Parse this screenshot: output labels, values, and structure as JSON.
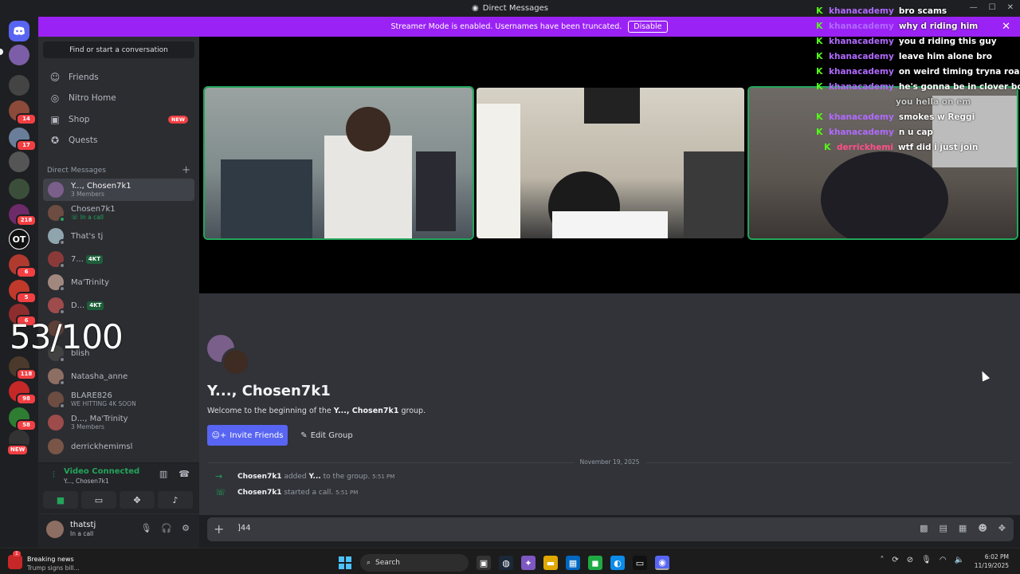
{
  "window": {
    "title": "Direct Messages"
  },
  "banner": {
    "text": "Streamer Mode is enabled. Usernames have been truncated.",
    "disable_label": "Disable"
  },
  "rail": {
    "badges": [
      "14",
      "17",
      "218",
      "6",
      "5",
      "6",
      "118",
      "98",
      "58",
      "NEW"
    ]
  },
  "sidebar": {
    "search_placeholder": "Find or start a conversation",
    "nav": [
      {
        "label": "Friends",
        "icon": "friends-icon"
      },
      {
        "label": "Nitro Home",
        "icon": "nitro-icon"
      },
      {
        "label": "Shop",
        "icon": "shop-icon",
        "badge": "NEW"
      },
      {
        "label": "Quests",
        "icon": "quests-icon"
      }
    ],
    "dm_header": "Direct Messages",
    "dms": [
      {
        "name": "Y..., Chosen7k1",
        "sub": "3 Members"
      },
      {
        "name": "Chosen7k1",
        "sub": "In a call"
      },
      {
        "name": "That's tj",
        "sub": ""
      },
      {
        "name": "7...",
        "sub": "",
        "tag": "4KT"
      },
      {
        "name": "Ma'Trinity",
        "sub": ""
      },
      {
        "name": "D...",
        "sub": "",
        "tag": "4KT"
      },
      {
        "name": "",
        "sub": ""
      },
      {
        "name": "blish",
        "sub": ""
      },
      {
        "name": "Natasha_anne",
        "sub": ""
      },
      {
        "name": "BLARE826",
        "sub": "WE HITTING 4K SOON"
      },
      {
        "name": "D..., Ma'Trinity",
        "sub": "3 Members"
      },
      {
        "name": "derrickhemimsl",
        "sub": ""
      }
    ]
  },
  "voice": {
    "status": "Video Connected",
    "channel": "Y..., Chosen7k1"
  },
  "user": {
    "name": "thatstj",
    "status": "In a call"
  },
  "group": {
    "title": "Y..., Chosen7k1",
    "welcome_prefix": "Welcome to the beginning of the ",
    "welcome_name": "Y..., Chosen7k1",
    "welcome_suffix": " group.",
    "invite_label": "Invite Friends",
    "edit_label": "Edit Group"
  },
  "messages": {
    "date": "November 19, 2025",
    "items": [
      {
        "actor": "Chosen7k1",
        "text_a": " added ",
        "target": "Y...",
        "text_b": " to the group.",
        "time": "5:51 PM"
      },
      {
        "actor": "Chosen7k1",
        "text_a": " started a call.",
        "target": "",
        "text_b": "",
        "time": "5:51 PM"
      }
    ]
  },
  "composer": {
    "value": "]44"
  },
  "overlay": {
    "counter": "53/100",
    "chat": [
      {
        "user": "khanacademy",
        "msg": "bro scams"
      },
      {
        "user": "khanacademy",
        "msg": "why d riding him"
      },
      {
        "user": "khanacademy",
        "msg": "you d riding this guy"
      },
      {
        "user": "khanacademy",
        "msg": "leave him alone bro"
      },
      {
        "user": "khanacademy",
        "msg": "on weird timing tryna roast p"
      },
      {
        "user": "khanacademy",
        "msg": "he's gonna be in clover boy h"
      },
      {
        "user": "",
        "msg": "you hella on em"
      },
      {
        "user": "khanacademy",
        "msg": "smokes w Reggi"
      },
      {
        "user": "khanacademy",
        "msg": "n u cap"
      },
      {
        "user": "derrickhemi",
        "msg": "wtf did i just join"
      }
    ]
  },
  "taskbar": {
    "news_title": "Breaking news",
    "news_sub": "Trump signs bill...",
    "news_badge": "1",
    "search_label": "Search",
    "time": "6:02 PM",
    "date": "11/19/2025"
  }
}
